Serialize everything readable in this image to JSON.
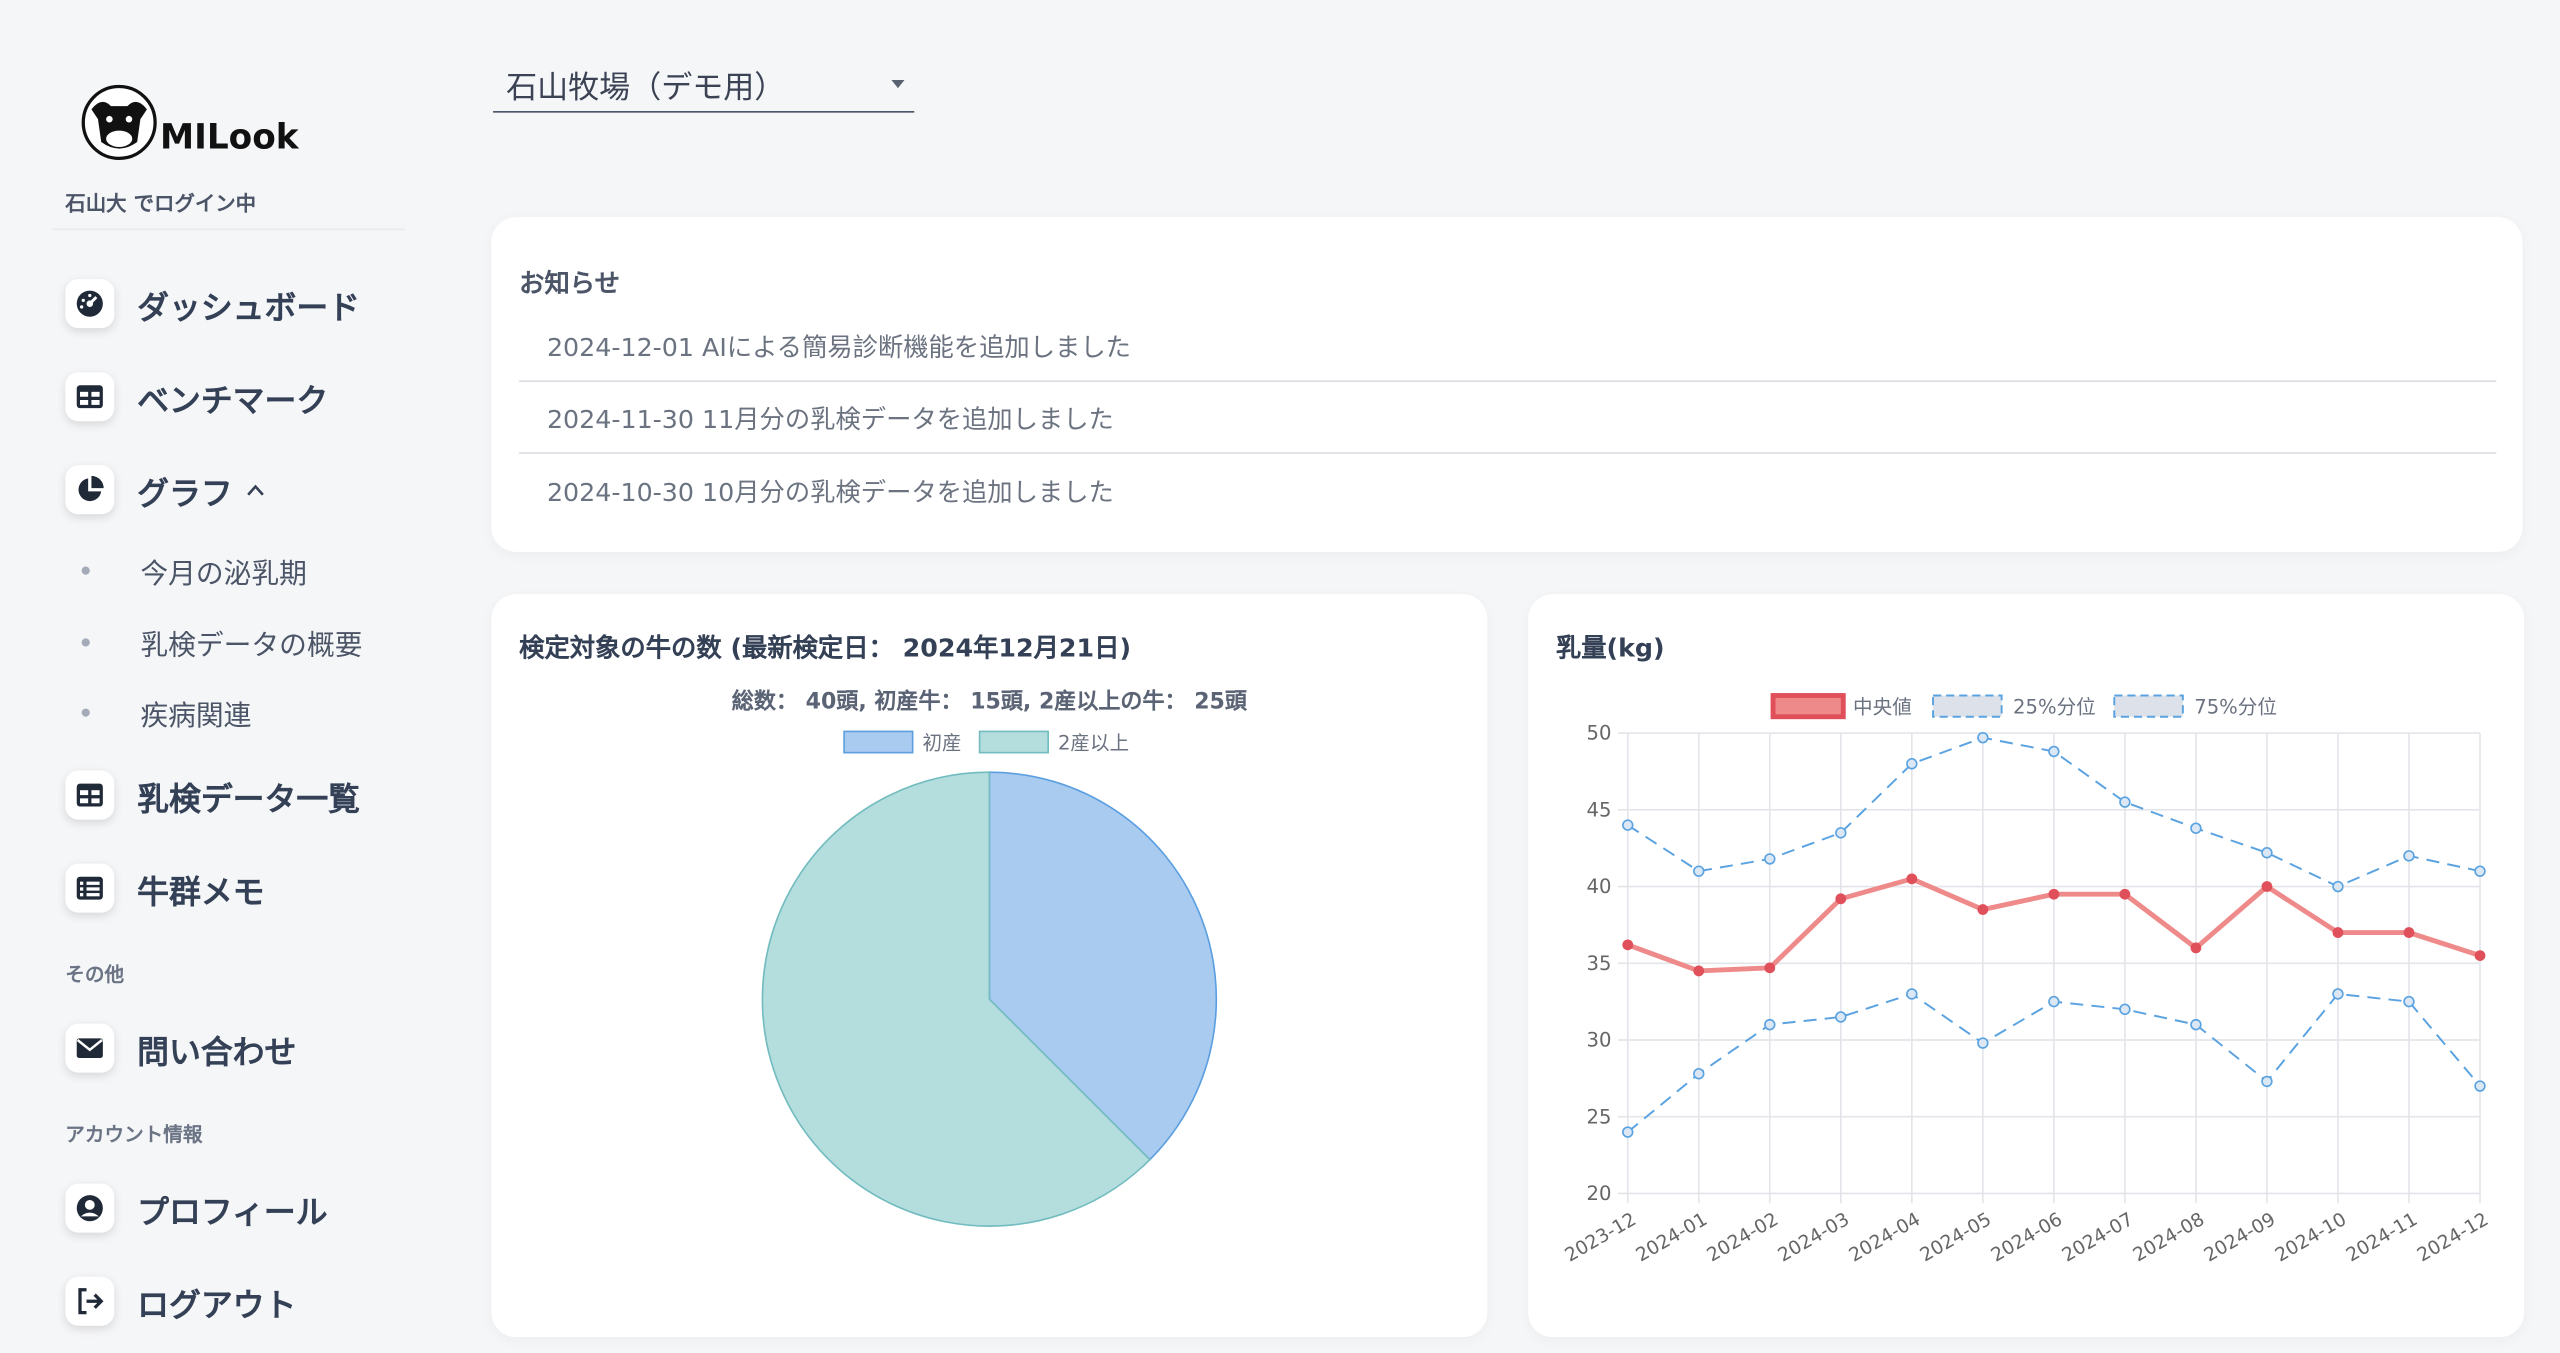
{
  "sidebar": {
    "logo_text": "MILook",
    "login_status": "石山大 でログイン中",
    "nav": {
      "dashboard": "ダッシュボード",
      "benchmark": "ベンチマーク",
      "graph": "グラフ",
      "milk_data_list": "乳検データ一覧",
      "herd_memo": "牛群メモ",
      "contact": "問い合わせ",
      "profile": "プロフィール",
      "logout": "ログアウト"
    },
    "graph_sub": [
      "今月の泌乳期",
      "乳検データの概要",
      "疾病関連"
    ],
    "section_other": "その他",
    "section_account": "アカウント情報"
  },
  "farm_select": {
    "value": "石山牧場（デモ用）"
  },
  "news": {
    "title": "お知らせ",
    "items": [
      "2024-12-01 AIによる簡易診断機能を追加しました",
      "2024-11-30 11月分の乳検データを追加しました",
      "2024-10-30 10月分の乳検データを追加しました"
    ]
  },
  "pie_card": {
    "title": "検定対象の牛の数 (最新検定日： 2024年12月21日)",
    "subtitle": "総数： 40頭, 初産牛： 15頭, 2産以上の牛： 25頭"
  },
  "line_card": {
    "title": "乳量(kg)"
  },
  "colors": {
    "primiparous_fill": "#a9cbf0",
    "primiparous_stroke": "#5c9fe0",
    "multiparous_fill": "#b4ddde",
    "multiparous_stroke": "#72bcbf",
    "median": "#ef8a8a",
    "median_point": "#e0505a",
    "quantile": "#5ba3e0"
  },
  "chart_data": [
    {
      "type": "pie",
      "categories": [
        "初産",
        "2産以上"
      ],
      "values": [
        15,
        25
      ],
      "legend": "top"
    },
    {
      "type": "line",
      "x": [
        "2023-12",
        "2024-01",
        "2024-02",
        "2024-03",
        "2024-04",
        "2024-05",
        "2024-06",
        "2024-07",
        "2024-08",
        "2024-09",
        "2024-10",
        "2024-11",
        "2024-12"
      ],
      "series": [
        {
          "name": "中央値",
          "values": [
            36.2,
            34.5,
            34.7,
            39.2,
            40.5,
            38.5,
            39.5,
            39.5,
            36.0,
            40.0,
            37.0,
            37.0,
            35.5
          ]
        },
        {
          "name": "25%分位",
          "values": [
            24.0,
            27.8,
            31.0,
            31.5,
            33.0,
            29.8,
            32.5,
            32.0,
            31.0,
            27.3,
            33.0,
            32.5,
            27.0
          ]
        },
        {
          "name": "75%分位",
          "values": [
            44.0,
            41.0,
            41.8,
            43.5,
            48.0,
            49.7,
            48.8,
            45.5,
            43.8,
            42.2,
            40.0,
            42.0,
            41.0
          ]
        }
      ],
      "ylim": [
        20,
        50
      ],
      "yticks": [
        20,
        25,
        30,
        35,
        40,
        45,
        50
      ],
      "grid": true,
      "legend": "top"
    }
  ]
}
